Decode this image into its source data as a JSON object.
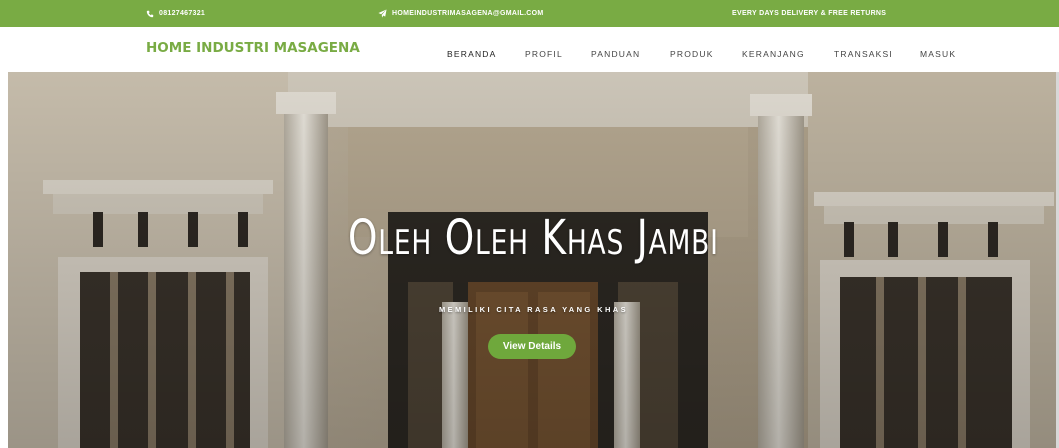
{
  "topbar": {
    "phone": "08127467321",
    "email": "HOMEINDUSTRIMASAGENA@GMAIL.COM",
    "delivery": "EVERY DAYS DELIVERY & FREE RETURNS",
    "phone_icon": "phone-icon",
    "email_icon": "paper-plane-icon"
  },
  "brand": "HOME INDUSTRI MASAGENA",
  "nav": {
    "items": [
      "BERANDA",
      "PROFIL",
      "PANDUAN",
      "PRODUK",
      "KERANJANG",
      "TRANSAKSI",
      "MASUK"
    ]
  },
  "hero": {
    "title": "Oleh Oleh Khas Jambi",
    "subtitle": "MEMILIKI CITA RASA YANG KHAS",
    "button": "View Details"
  },
  "colors": {
    "accent": "#79ab44",
    "button": "#6fa83c"
  }
}
